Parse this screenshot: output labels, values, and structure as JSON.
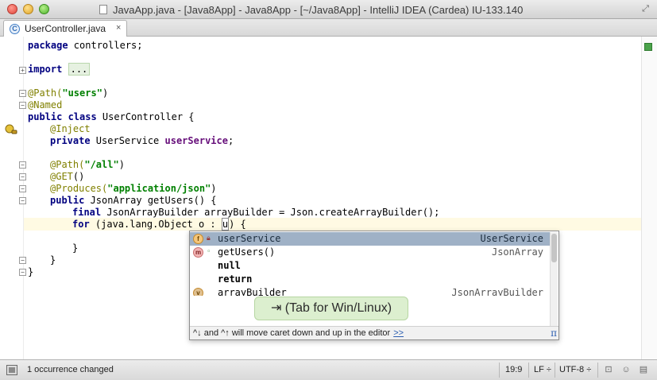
{
  "window": {
    "title": "JavaApp.java - [Java8App] - Java8App - [~/Java8App] - IntelliJ IDEA (Cardea) IU-133.140"
  },
  "tabs": [
    {
      "label": "UserController.java",
      "icon": "java-class-icon",
      "close": "×"
    }
  ],
  "code": {
    "l1_kw": "package",
    "l1_rest": " controllers;",
    "l2_kw": "import",
    "l2_dots": "...",
    "l3_an": "@Path(",
    "l3_str": "\"users\"",
    "l3_end": ")",
    "l4_an": "@Named",
    "l5_kw": "public class",
    "l5_rest": " UserController {",
    "l6_an": "@Inject",
    "l7_kw": "private",
    "l7_mid": " UserService ",
    "l7_fld": "userService",
    "l7_end": ";",
    "l8_an": "@Path(",
    "l8_str": "\"/all\"",
    "l8_end": ")",
    "l9_an": "@GET",
    "l9_end": "()",
    "l10_an": "@Produces(",
    "l10_str": "\"application/json\"",
    "l10_end": ")",
    "l11_kw": "public",
    "l11_rest": " JsonArray getUsers() {",
    "l12_kw": "final",
    "l12_rest": " JsonArrayBuilder arrayBuilder = Json.createArrayBuilder();",
    "l13_kw": "for",
    "l13_rest": " (java.lang.Object o : ",
    "l13_u": "u",
    "l13_end": ") {",
    "l14": "}",
    "l15": "}",
    "l16": "}"
  },
  "completion": {
    "items": [
      {
        "name": "userService",
        "type": "UserService",
        "icon": "f"
      },
      {
        "name": "getUsers()",
        "type": "JsonArray",
        "icon": "m"
      },
      {
        "name": "null",
        "type": ""
      },
      {
        "name": "return",
        "type": ""
      },
      {
        "name": "arrayBuilder",
        "type": "JsonArrayBuilder",
        "icon": "v"
      }
    ],
    "footer": "^↓ and ^↑ will move caret down and up in the editor",
    "footer_link": ">>",
    "pi": "π"
  },
  "hint": "⇥ (Tab for Win/Linux)",
  "status": {
    "message": "1 occurrence changed",
    "position": "19:9",
    "line_sep": "LF ÷",
    "encoding": "UTF-8 ÷"
  },
  "colors": {
    "keyword": "#000080",
    "annotation": "#808000",
    "string": "#008000",
    "field": "#660e7a",
    "selection": "#9fb1c6",
    "caret_line": "#fffae3",
    "hint_bg": "#dcefcf"
  }
}
